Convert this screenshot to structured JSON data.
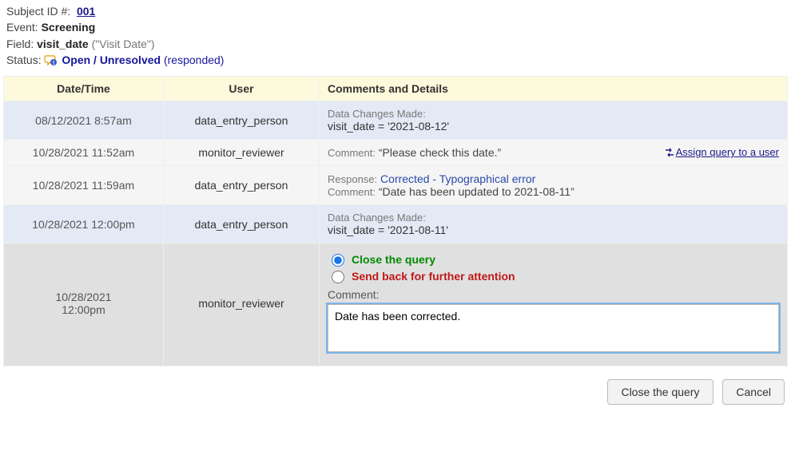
{
  "header": {
    "subject_label": "Subject ID #:",
    "subject_id": "001",
    "event_label": "Event:",
    "event": "Screening",
    "field_label": "Field:",
    "field_name": "visit_date",
    "field_display": "(\"Visit Date\")",
    "status_label": "Status:",
    "status_value": "Open / Unresolved",
    "status_extra": "(responded)"
  },
  "table": {
    "headers": {
      "dt": "Date/Time",
      "user": "User",
      "comm": "Comments and Details"
    }
  },
  "rows": [
    {
      "dt": "08/12/2021 8:57am",
      "user": "data_entry_person",
      "dcm_label": "Data Changes Made:",
      "dcm_value": "visit_date = '2021-08-12'"
    },
    {
      "dt": "10/28/2021 11:52am",
      "user": "monitor_reviewer",
      "comment_label": "Comment:",
      "comment_text": "“Please check this date.”",
      "assign_label": "Assign query to a user"
    },
    {
      "dt": "10/28/2021 11:59am",
      "user": "data_entry_person",
      "response_label": "Response:",
      "response_text": "Corrected - Typographical error",
      "comment_label": "Comment:",
      "comment_text": "“Date has been updated to 2021-08-11”"
    },
    {
      "dt": "10/28/2021 12:00pm",
      "user": "data_entry_person",
      "dcm_label": "Data Changes Made:",
      "dcm_value": "visit_date = '2021-08-11'"
    }
  ],
  "input_row": {
    "dt_line1": "10/28/2021",
    "dt_line2": "12:00pm",
    "user": "monitor_reviewer",
    "opt_close": "Close the query",
    "opt_sendback": "Send back for further attention",
    "comment_label": "Comment:",
    "comment_value": "Date has been corrected."
  },
  "buttons": {
    "close": "Close the query",
    "cancel": "Cancel"
  }
}
